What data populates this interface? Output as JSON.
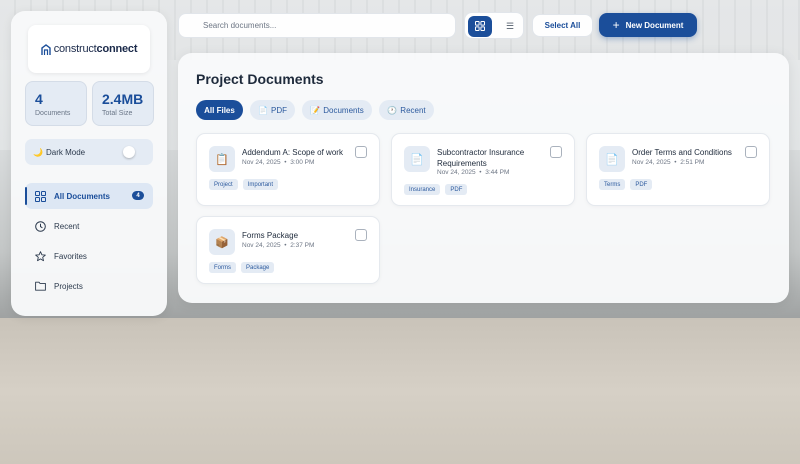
{
  "brand": {
    "logo_light": "construct",
    "logo_bold": "connect"
  },
  "stats": [
    {
      "value": "4",
      "label": "Documents"
    },
    {
      "value": "2.4MB",
      "label": "Total Size"
    }
  ],
  "dark_mode": {
    "icon": "🌙",
    "label": "Dark Mode",
    "enabled": false
  },
  "nav": [
    {
      "label": "All Documents",
      "icon": "grid-icon",
      "badge": "4",
      "active": true
    },
    {
      "label": "Recent",
      "icon": "clock-icon",
      "active": false
    },
    {
      "label": "Favorites",
      "icon": "star-icon",
      "active": false
    },
    {
      "label": "Projects",
      "icon": "folder-icon",
      "active": false
    }
  ],
  "toolbar": {
    "search_placeholder": "Search documents...",
    "view_mode": "grid",
    "list_glyph": "☰",
    "select_all": "Select All",
    "new_document": "New Document",
    "new_plus": "+"
  },
  "main": {
    "title": "Project Documents",
    "filters": [
      {
        "icon": "",
        "label": "All Files",
        "active": true
      },
      {
        "icon": "📄",
        "label": "PDF",
        "active": false
      },
      {
        "icon": "📝",
        "label": "Documents",
        "active": false
      },
      {
        "icon": "🕐",
        "label": "Recent",
        "active": false
      }
    ],
    "documents": [
      {
        "icon": "📋",
        "title": "Addendum A: Scope of work",
        "date": "Nov 24, 2025",
        "time": "3:00 PM",
        "sep": "•",
        "tags": [
          "Project",
          "Important"
        ]
      },
      {
        "icon": "📄",
        "title": "Subcontractor Insurance Requirements",
        "date": "Nov 24, 2025",
        "time": "3:44 PM",
        "sep": "•",
        "tags": [
          "Insurance",
          "PDF"
        ]
      },
      {
        "icon": "📄",
        "title": "Order Terms and Conditions",
        "date": "Nov 24, 2025",
        "time": "2:51 PM",
        "sep": "•",
        "tags": [
          "Terms",
          "PDF"
        ]
      },
      {
        "icon": "📦",
        "title": "Forms Package",
        "date": "Nov 24, 2025",
        "time": "2:37 PM",
        "sep": "•",
        "tags": [
          "Forms",
          "Package"
        ]
      }
    ]
  },
  "colors": {
    "accent": "#1b4e9a",
    "tag_bg": "#e4ebf4"
  }
}
